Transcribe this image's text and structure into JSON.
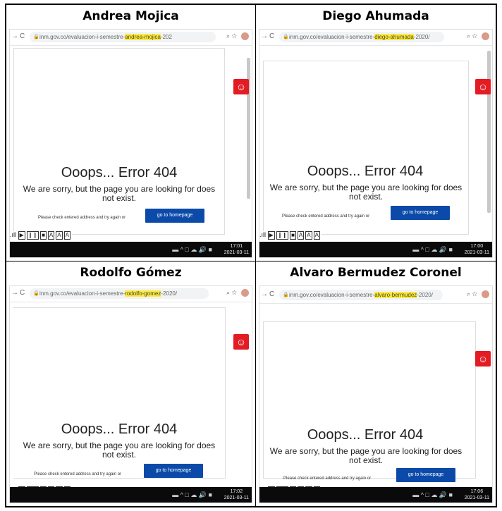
{
  "panels": [
    {
      "name": "Andrea Mojica",
      "url_prefix": "inm.gov.co/evaluacion-i-semestre-",
      "url_highlight": "andrea-mojica",
      "url_suffix": "-202",
      "error_title": "Ooops... Error 404",
      "error_message": "We are sorry, but the page you are looking for does not exist.",
      "check_text": "Please check entered address and try again or",
      "button_label": "go to homepage",
      "time": "17:01",
      "date": "2021-03-11"
    },
    {
      "name": "Diego Ahumada",
      "url_prefix": "inm.gov.co/evaluacion-i-semestre-",
      "url_highlight": "diego-ahumada",
      "url_suffix": "-2020/",
      "error_title": "Ooops... Error 404",
      "error_message": "We are sorry, but the page you are looking for does not exist.",
      "check_text": "Please check entered address and try again or",
      "button_label": "go to homepage",
      "time": "17:00",
      "date": "2021-03-11"
    },
    {
      "name": "Rodolfo Gómez",
      "url_prefix": "inm.gov.co/evaluacion-i-semestre-",
      "url_highlight": "rodolfo-gomez",
      "url_suffix": "-2020/",
      "error_title": "Ooops... Error 404",
      "error_message": "We are sorry, but the page you are looking for does not exist.",
      "check_text": "Please check entered address and try again or",
      "button_label": "go to homepage",
      "time": "17:02",
      "date": "2021-03-11"
    },
    {
      "name": "Alvaro Bermudez Coronel",
      "url_prefix": "inm.gov.co/evaluacion-i-semestre-",
      "url_highlight": "alvaro-bermudez",
      "url_suffix": "-2020/",
      "error_title": "Ooops... Error 404",
      "error_message": "We are sorry, but the page you are looking for does not exist.",
      "check_text": "Please check entered address and try again or",
      "button_label": "go to homepage",
      "time": "17:06",
      "date": "2021-03-11"
    }
  ],
  "colors": {
    "accessibility_red": "#e31b23",
    "button_blue": "#0b4aa8",
    "highlight": "#ffeb3b",
    "taskbar": "#0a0a0a"
  },
  "icons": [
    "back-arrow-icon",
    "reload-icon",
    "lock-icon",
    "zoom-icon",
    "star-icon",
    "accessibility-icon"
  ]
}
